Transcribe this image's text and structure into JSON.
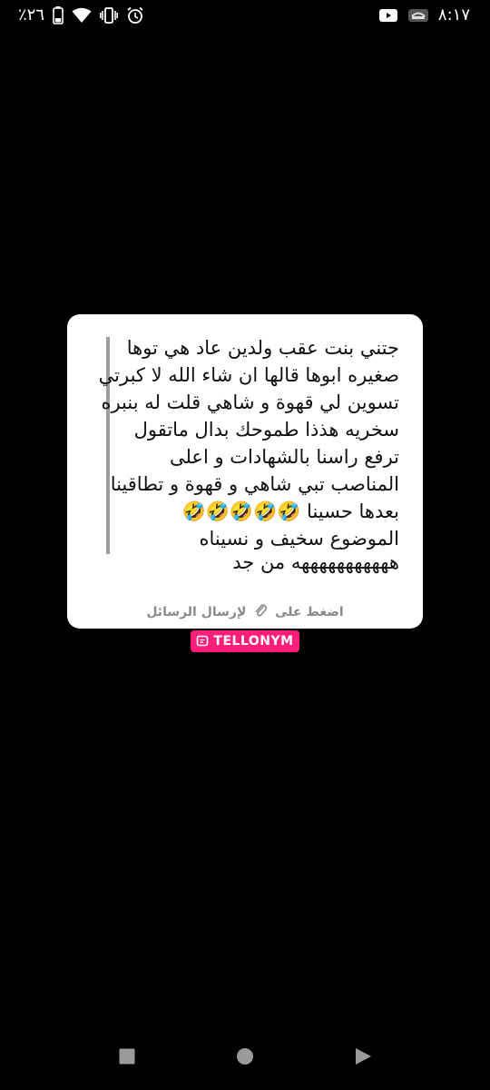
{
  "status_bar": {
    "time": "٨:١٧",
    "battery": "٪٢٦",
    "icons": [
      "battery-icon",
      "wifi-icon",
      "vibrate-icon",
      "alarm-icon",
      "cast-icon",
      "app-notification-icon"
    ]
  },
  "card": {
    "quote_lines": [
      "جتني بنت عقب ولدين عاد هي توها",
      "صغيره ابوها قالها ان شاء الله لا كبرتي",
      "تسوين لي قهوة و شاهي قلت له بنبره",
      "سخريه هذذا طموحك بدال ماتقول",
      "ترفع راسنا بالشهادات و اعلى",
      "المناصب تبي شاهي و قهوة و تطاقينا",
      "بعدها حسينا 🤣🤣🤣🤣🤣",
      "الموضوع سخيف و نسيناه"
    ],
    "answer": "هههههههههههه من جد",
    "footer_before": "اضغط على",
    "footer_after": "لإرسال الرسائل"
  },
  "brand": {
    "label": "TELLONYM",
    "color": "#ff1f7a"
  },
  "nav": {
    "icons": [
      "recents-icon",
      "home-icon",
      "back-icon"
    ]
  }
}
